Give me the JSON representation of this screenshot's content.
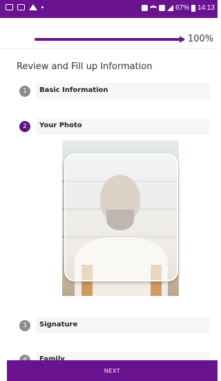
{
  "status_bar": {
    "battery_percent": "67%",
    "time": "14:13",
    "left_icons": [
      "image-icon",
      "message-icon",
      "location-icon",
      "dot-icon"
    ],
    "right_icons": [
      "alarm-icon",
      "wifi-icon",
      "data-icon",
      "signal-icon",
      "battery-icon"
    ]
  },
  "progress": {
    "value": 1.0,
    "label": "100%"
  },
  "form": {
    "title": "Review and Fill up Information",
    "steps": [
      {
        "number": "1",
        "label": "Basic Information"
      },
      {
        "number": "2",
        "label": "Your Photo"
      },
      {
        "number": "3",
        "label": "Signature"
      },
      {
        "number": "4",
        "label": "Family"
      }
    ]
  },
  "footer": {
    "next_label": "NEXT"
  },
  "colors": {
    "primary": "#6a1390",
    "active_step": "#5b1484",
    "inactive_step": "#8a8a8a"
  }
}
